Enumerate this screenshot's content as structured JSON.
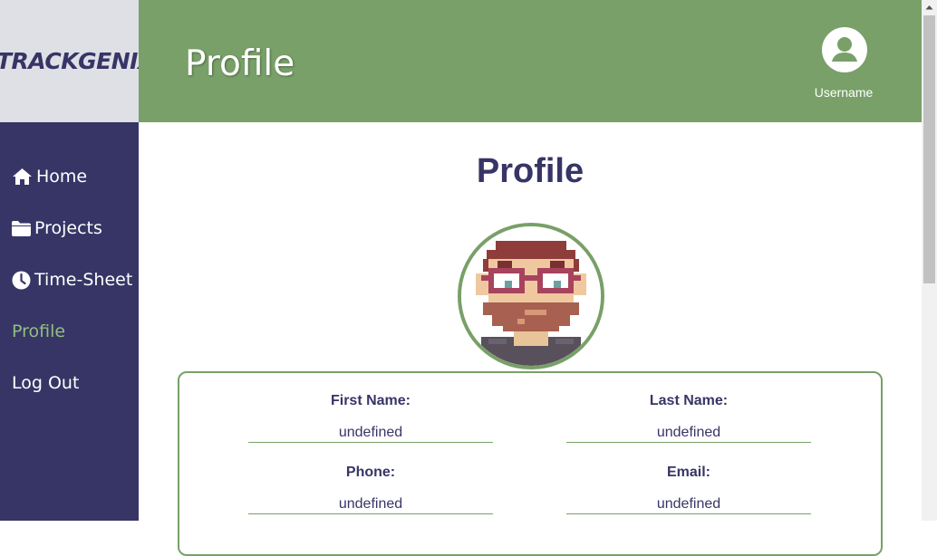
{
  "app": {
    "logo_text": "TRACKGENIX"
  },
  "header": {
    "title": "Profile",
    "username": "Username"
  },
  "sidebar": {
    "items": [
      {
        "label": "Home",
        "icon": "home-icon"
      },
      {
        "label": "Projects",
        "icon": "folder-icon"
      },
      {
        "label": "Time-Sheet",
        "icon": "clock-icon"
      },
      {
        "label": "Profile",
        "active": true
      },
      {
        "label": "Log Out"
      }
    ]
  },
  "main": {
    "title": "Profile",
    "avatar_icon": "pixel-avatar",
    "fields": [
      {
        "label": "First Name:",
        "value": "undefined"
      },
      {
        "label": "Last Name:",
        "value": "undefined"
      },
      {
        "label": "Phone:",
        "value": "undefined"
      },
      {
        "label": "Email:",
        "value": "undefined"
      }
    ]
  },
  "colors": {
    "primary": "#373566",
    "accent_green": "#78a068",
    "active_nav": "#8fbf7f",
    "logo_bg": "#dfdfe6"
  }
}
